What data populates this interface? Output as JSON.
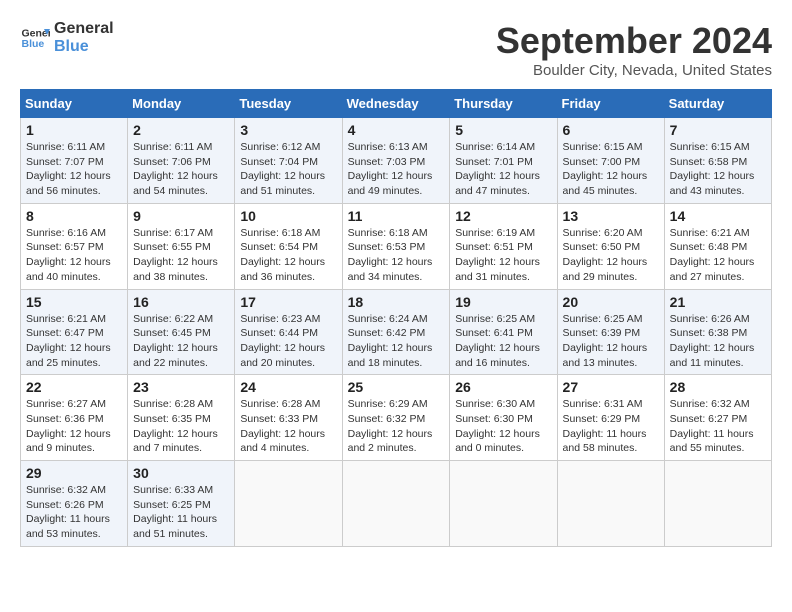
{
  "logo": {
    "line1": "General",
    "line2": "Blue"
  },
  "title": "September 2024",
  "subtitle": "Boulder City, Nevada, United States",
  "days_of_week": [
    "Sunday",
    "Monday",
    "Tuesday",
    "Wednesday",
    "Thursday",
    "Friday",
    "Saturday"
  ],
  "weeks": [
    [
      {
        "day": "1",
        "info": "Sunrise: 6:11 AM\nSunset: 7:07 PM\nDaylight: 12 hours\nand 56 minutes."
      },
      {
        "day": "2",
        "info": "Sunrise: 6:11 AM\nSunset: 7:06 PM\nDaylight: 12 hours\nand 54 minutes."
      },
      {
        "day": "3",
        "info": "Sunrise: 6:12 AM\nSunset: 7:04 PM\nDaylight: 12 hours\nand 51 minutes."
      },
      {
        "day": "4",
        "info": "Sunrise: 6:13 AM\nSunset: 7:03 PM\nDaylight: 12 hours\nand 49 minutes."
      },
      {
        "day": "5",
        "info": "Sunrise: 6:14 AM\nSunset: 7:01 PM\nDaylight: 12 hours\nand 47 minutes."
      },
      {
        "day": "6",
        "info": "Sunrise: 6:15 AM\nSunset: 7:00 PM\nDaylight: 12 hours\nand 45 minutes."
      },
      {
        "day": "7",
        "info": "Sunrise: 6:15 AM\nSunset: 6:58 PM\nDaylight: 12 hours\nand 43 minutes."
      }
    ],
    [
      {
        "day": "8",
        "info": "Sunrise: 6:16 AM\nSunset: 6:57 PM\nDaylight: 12 hours\nand 40 minutes."
      },
      {
        "day": "9",
        "info": "Sunrise: 6:17 AM\nSunset: 6:55 PM\nDaylight: 12 hours\nand 38 minutes."
      },
      {
        "day": "10",
        "info": "Sunrise: 6:18 AM\nSunset: 6:54 PM\nDaylight: 12 hours\nand 36 minutes."
      },
      {
        "day": "11",
        "info": "Sunrise: 6:18 AM\nSunset: 6:53 PM\nDaylight: 12 hours\nand 34 minutes."
      },
      {
        "day": "12",
        "info": "Sunrise: 6:19 AM\nSunset: 6:51 PM\nDaylight: 12 hours\nand 31 minutes."
      },
      {
        "day": "13",
        "info": "Sunrise: 6:20 AM\nSunset: 6:50 PM\nDaylight: 12 hours\nand 29 minutes."
      },
      {
        "day": "14",
        "info": "Sunrise: 6:21 AM\nSunset: 6:48 PM\nDaylight: 12 hours\nand 27 minutes."
      }
    ],
    [
      {
        "day": "15",
        "info": "Sunrise: 6:21 AM\nSunset: 6:47 PM\nDaylight: 12 hours\nand 25 minutes."
      },
      {
        "day": "16",
        "info": "Sunrise: 6:22 AM\nSunset: 6:45 PM\nDaylight: 12 hours\nand 22 minutes."
      },
      {
        "day": "17",
        "info": "Sunrise: 6:23 AM\nSunset: 6:44 PM\nDaylight: 12 hours\nand 20 minutes."
      },
      {
        "day": "18",
        "info": "Sunrise: 6:24 AM\nSunset: 6:42 PM\nDaylight: 12 hours\nand 18 minutes."
      },
      {
        "day": "19",
        "info": "Sunrise: 6:25 AM\nSunset: 6:41 PM\nDaylight: 12 hours\nand 16 minutes."
      },
      {
        "day": "20",
        "info": "Sunrise: 6:25 AM\nSunset: 6:39 PM\nDaylight: 12 hours\nand 13 minutes."
      },
      {
        "day": "21",
        "info": "Sunrise: 6:26 AM\nSunset: 6:38 PM\nDaylight: 12 hours\nand 11 minutes."
      }
    ],
    [
      {
        "day": "22",
        "info": "Sunrise: 6:27 AM\nSunset: 6:36 PM\nDaylight: 12 hours\nand 9 minutes."
      },
      {
        "day": "23",
        "info": "Sunrise: 6:28 AM\nSunset: 6:35 PM\nDaylight: 12 hours\nand 7 minutes."
      },
      {
        "day": "24",
        "info": "Sunrise: 6:28 AM\nSunset: 6:33 PM\nDaylight: 12 hours\nand 4 minutes."
      },
      {
        "day": "25",
        "info": "Sunrise: 6:29 AM\nSunset: 6:32 PM\nDaylight: 12 hours\nand 2 minutes."
      },
      {
        "day": "26",
        "info": "Sunrise: 6:30 AM\nSunset: 6:30 PM\nDaylight: 12 hours\nand 0 minutes."
      },
      {
        "day": "27",
        "info": "Sunrise: 6:31 AM\nSunset: 6:29 PM\nDaylight: 11 hours\nand 58 minutes."
      },
      {
        "day": "28",
        "info": "Sunrise: 6:32 AM\nSunset: 6:27 PM\nDaylight: 11 hours\nand 55 minutes."
      }
    ],
    [
      {
        "day": "29",
        "info": "Sunrise: 6:32 AM\nSunset: 6:26 PM\nDaylight: 11 hours\nand 53 minutes."
      },
      {
        "day": "30",
        "info": "Sunrise: 6:33 AM\nSunset: 6:25 PM\nDaylight: 11 hours\nand 51 minutes."
      },
      {
        "day": "",
        "info": ""
      },
      {
        "day": "",
        "info": ""
      },
      {
        "day": "",
        "info": ""
      },
      {
        "day": "",
        "info": ""
      },
      {
        "day": "",
        "info": ""
      }
    ]
  ]
}
